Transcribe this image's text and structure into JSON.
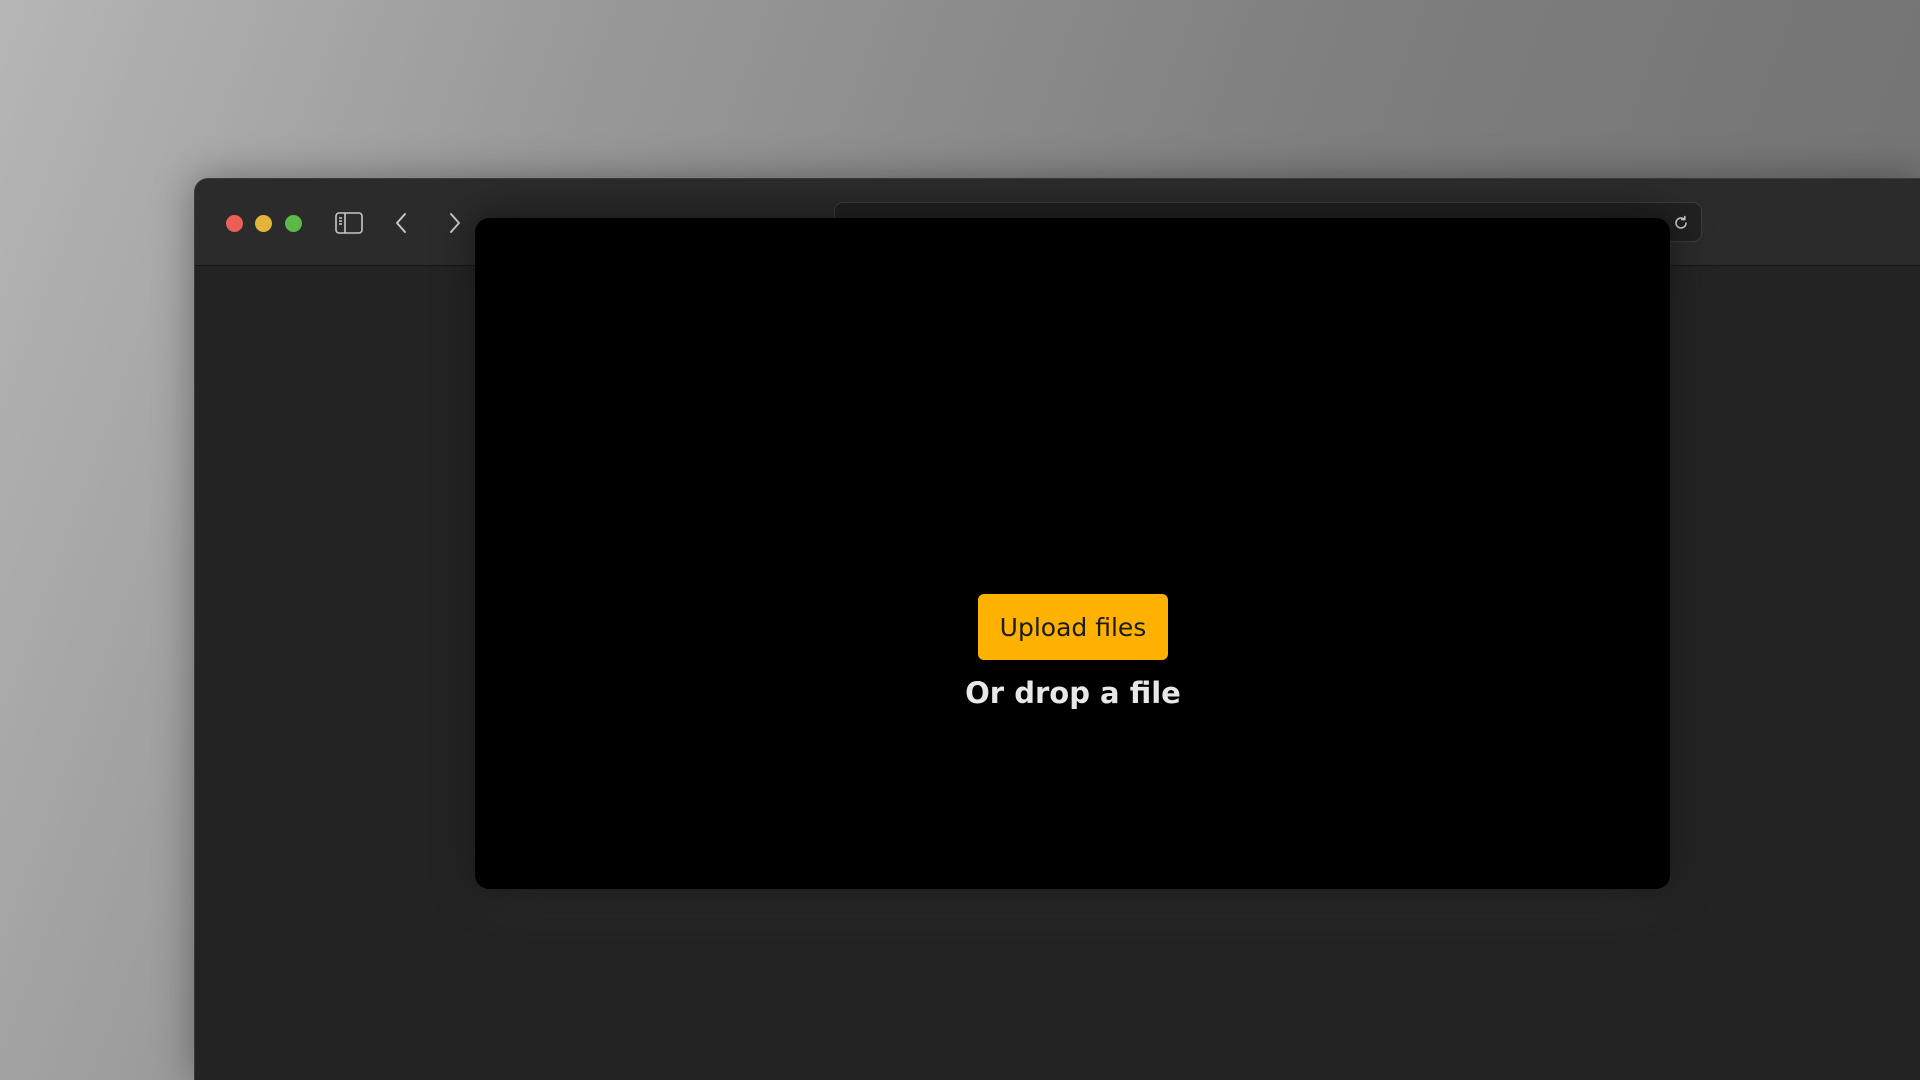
{
  "toolbar": {
    "traffic_lights": {
      "close": "#ec5f57",
      "minimize": "#e3b43c",
      "zoom": "#5ab947"
    },
    "icons": {
      "sidebar": "sidebar-icon",
      "back": "chevron-left-icon",
      "forward": "chevron-right-icon",
      "reload": "reload-icon"
    },
    "address": {
      "value": "",
      "placeholder": ""
    }
  },
  "dropzone": {
    "upload_label": "Upload files",
    "drop_text": "Or drop a file",
    "accent": "#ffb100"
  }
}
